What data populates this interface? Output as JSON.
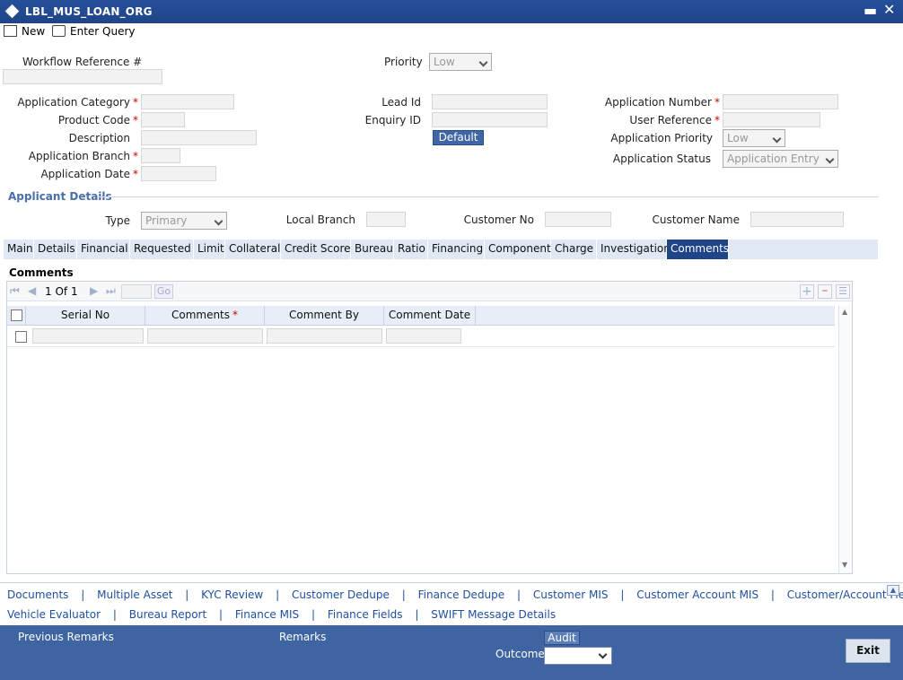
{
  "window": {
    "title": "LBL_MUS_LOAN_ORG"
  },
  "toolbar": {
    "new_label": "New",
    "enter_query_label": "Enter Query"
  },
  "header": {
    "workflow_ref_label": "Workflow Reference #",
    "priority_label": "Priority",
    "priority_value": "Low"
  },
  "form": {
    "application_category_label": "Application Category",
    "product_code_label": "Product Code",
    "description_label": "Description",
    "application_branch_label": "Application Branch",
    "application_date_label": "Application Date",
    "lead_id_label": "Lead Id",
    "enquiry_id_label": "Enquiry ID",
    "default_button": "Default",
    "application_number_label": "Application Number",
    "user_reference_label": "User Reference",
    "application_priority_label": "Application Priority",
    "application_priority_value": "Low",
    "application_status_label": "Application Status",
    "application_status_value": "Application Entry",
    "required_marker": "*"
  },
  "applicant": {
    "section_title": "Applicant Details",
    "type_label": "Type",
    "type_value": "Primary",
    "local_branch_label": "Local Branch",
    "customer_no_label": "Customer No",
    "customer_name_label": "Customer Name"
  },
  "tabs": [
    {
      "label": "Main"
    },
    {
      "label": "Details"
    },
    {
      "label": "Financial"
    },
    {
      "label": "Requested"
    },
    {
      "label": "Limit"
    },
    {
      "label": "Collateral"
    },
    {
      "label": "Credit Score"
    },
    {
      "label": "Bureau"
    },
    {
      "label": "Ratio"
    },
    {
      "label": "Financing"
    },
    {
      "label": "Component"
    },
    {
      "label": "Charge"
    },
    {
      "label": "Investigation"
    },
    {
      "label": "Comments"
    }
  ],
  "active_tab": "Comments",
  "comments": {
    "section_title": "Comments",
    "pager": {
      "page": "1",
      "of_label": "Of",
      "total": "1",
      "go_label": "Go"
    },
    "columns": [
      "Serial No",
      "Comments",
      "Comment By",
      "Comment Date"
    ],
    "required_marker": "*"
  },
  "links": {
    "row1": [
      "Documents",
      "Multiple Asset",
      "KYC Review",
      "Customer Dedupe",
      "Finance Dedupe",
      "Customer MIS",
      "Customer Account MIS",
      "Customer/Account Fields"
    ],
    "row2": [
      "Vehicle Evaluator",
      "Bureau Report",
      "Finance MIS",
      "Finance Fields",
      "SWIFT Message Details"
    ],
    "separator": "|"
  },
  "footer": {
    "previous_remarks_label": "Previous Remarks",
    "remarks_label": "Remarks",
    "audit_label": "Audit",
    "outcome_label": "Outcome",
    "exit_label": "Exit"
  },
  "colors": {
    "title_bar": "#1f4488",
    "footer": "#3e65a2",
    "link": "#1f4f9c",
    "active_tab": "#1f4488"
  }
}
